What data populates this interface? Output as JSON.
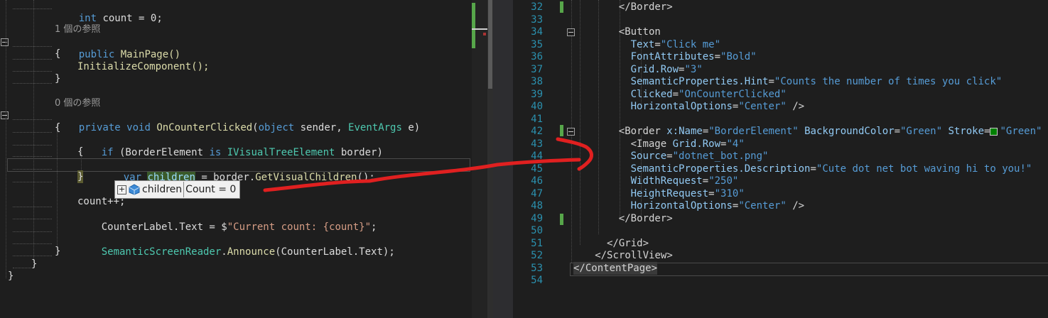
{
  "left_code": {
    "line_int": [
      "int",
      " count ",
      "=",
      " 0;"
    ],
    "ref1": "1 個の参照",
    "line_public": [
      "public",
      " MainPage()"
    ],
    "brace_open": "{",
    "init": "InitializeComponent();",
    "brace_close": "}",
    "ref2": "0 個の参照",
    "line_private": [
      "private",
      " void ",
      "OnCounterClicked",
      "(",
      "object",
      " sender, ",
      "EventArgs",
      " e)"
    ],
    "brace_open2": "{",
    "if_line": [
      "if",
      " (BorderElement ",
      "is",
      " IVisualTreeElement",
      " border)"
    ],
    "brace_open3": "{",
    "var_line": [
      "var",
      " ",
      "children",
      " = border.",
      "GetVisualChildren",
      "();"
    ],
    "brace_close3": "}",
    "count_inc": "count++;",
    "label_line": [
      "CounterLabel.Text = $",
      "\"Current count: {count}\"",
      ";"
    ],
    "announce_line": [
      "SemanticScreenReader",
      ".",
      "Announce",
      "(CounterLabel.Text);"
    ],
    "brace_close2": "}",
    "brace_close_class": "}",
    "brace_close_ns": "}"
  },
  "tooltip": {
    "expand": "+",
    "name": "children",
    "value": "Count = 0"
  },
  "right_code": {
    "lines": [
      {
        "num": "32",
        "indent": 7,
        "parts": [
          [
            "tag",
            "</Border>"
          ]
        ]
      },
      {
        "num": "33",
        "indent": 0,
        "parts": []
      },
      {
        "num": "34",
        "indent": 7,
        "parts": [
          [
            "tag",
            "<Button"
          ]
        ]
      },
      {
        "num": "35",
        "indent": 9,
        "parts": [
          [
            "attr",
            "Text"
          ],
          [
            "tag",
            "="
          ],
          [
            "xstr",
            "\"Click me\""
          ]
        ]
      },
      {
        "num": "36",
        "indent": 9,
        "parts": [
          [
            "attr",
            "FontAttributes"
          ],
          [
            "tag",
            "="
          ],
          [
            "xstr",
            "\"Bold\""
          ]
        ]
      },
      {
        "num": "37",
        "indent": 9,
        "parts": [
          [
            "attr",
            "Grid.Row"
          ],
          [
            "tag",
            "="
          ],
          [
            "xstr",
            "\"3\""
          ]
        ]
      },
      {
        "num": "38",
        "indent": 9,
        "parts": [
          [
            "attr",
            "SemanticProperties.Hint"
          ],
          [
            "tag",
            "="
          ],
          [
            "xstr",
            "\"Counts the number of times you click\""
          ]
        ]
      },
      {
        "num": "39",
        "indent": 9,
        "parts": [
          [
            "attr",
            "Clicked"
          ],
          [
            "tag",
            "="
          ],
          [
            "xstr",
            "\"OnCounterClicked\""
          ]
        ]
      },
      {
        "num": "40",
        "indent": 9,
        "parts": [
          [
            "attr",
            "HorizontalOptions"
          ],
          [
            "tag",
            "="
          ],
          [
            "xstr",
            "\"Center\""
          ],
          [
            "tag",
            " />"
          ]
        ]
      },
      {
        "num": "41",
        "indent": 0,
        "parts": []
      },
      {
        "num": "42",
        "indent": 7,
        "parts": [
          [
            "tag",
            "<Border "
          ],
          [
            "attr",
            "x:Name"
          ],
          [
            "tag",
            "="
          ],
          [
            "xstr",
            "\"BorderElement\""
          ],
          [
            "tag",
            " "
          ],
          [
            "attr",
            "BackgroundColor"
          ],
          [
            "tag",
            "="
          ],
          [
            "xstr",
            "\"Green\""
          ],
          [
            "tag",
            " "
          ],
          [
            "attr",
            "Stroke"
          ],
          [
            "tag",
            "="
          ],
          [
            "swatch",
            ""
          ],
          [
            "xstr",
            "\"Green\""
          ]
        ]
      },
      {
        "num": "43",
        "indent": 9,
        "parts": [
          [
            "tag",
            "<Image "
          ],
          [
            "attr",
            "Grid.Row"
          ],
          [
            "tag",
            "="
          ],
          [
            "xstr",
            "\"4\""
          ]
        ]
      },
      {
        "num": "44",
        "indent": 9,
        "parts": [
          [
            "attr",
            "Source"
          ],
          [
            "tag",
            "="
          ],
          [
            "xstr",
            "\"dotnet_bot.png\""
          ]
        ]
      },
      {
        "num": "45",
        "indent": 9,
        "parts": [
          [
            "attr",
            "SemanticProperties.Description"
          ],
          [
            "tag",
            "="
          ],
          [
            "xstr",
            "\"Cute dot net bot waving hi to you!\""
          ]
        ]
      },
      {
        "num": "46",
        "indent": 9,
        "parts": [
          [
            "attr",
            "WidthRequest"
          ],
          [
            "tag",
            "="
          ],
          [
            "xstr",
            "\"250\""
          ]
        ]
      },
      {
        "num": "47",
        "indent": 9,
        "parts": [
          [
            "attr",
            "HeightRequest"
          ],
          [
            "tag",
            "="
          ],
          [
            "xstr",
            "\"310\""
          ]
        ]
      },
      {
        "num": "48",
        "indent": 9,
        "parts": [
          [
            "attr",
            "HorizontalOptions"
          ],
          [
            "tag",
            "="
          ],
          [
            "xstr",
            "\"Center\""
          ],
          [
            "tag",
            " />"
          ]
        ]
      },
      {
        "num": "49",
        "indent": 7,
        "parts": [
          [
            "tag",
            "</Border>"
          ]
        ]
      },
      {
        "num": "50",
        "indent": 0,
        "parts": []
      },
      {
        "num": "51",
        "indent": 5,
        "parts": [
          [
            "tag",
            "</Grid>"
          ]
        ]
      },
      {
        "num": "52",
        "indent": 3,
        "parts": [
          [
            "tag",
            "</ScrollView>"
          ]
        ]
      },
      {
        "num": "53",
        "indent": 0,
        "parts": [
          [
            "tag",
            "</ContentPage>"
          ]
        ]
      },
      {
        "num": "54",
        "indent": 0,
        "parts": []
      }
    ]
  },
  "colors": {
    "background": "#1e1e1e",
    "keyword": "#569cd6",
    "type": "#4ec9b0",
    "method": "#dcdcaa",
    "string": "#d69d85",
    "line_number": "#2b91af",
    "change_bar": "#57a64a",
    "annotation": "#e02020"
  }
}
